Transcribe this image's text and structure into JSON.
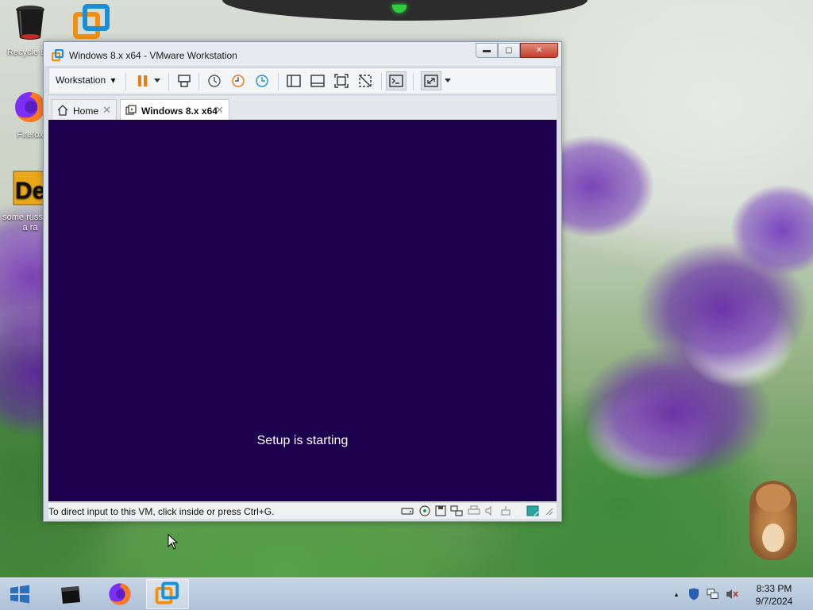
{
  "desktop": {
    "icons": [
      {
        "label": "Recycle Bin",
        "icon": "recycle-bin-icon"
      },
      {
        "label": "",
        "icon": "vmware-icon"
      },
      {
        "label": "Firefox",
        "icon": "firefox-icon"
      },
      {
        "label": "some russ ran a ra",
        "icon": "document-icon"
      }
    ]
  },
  "window": {
    "title": "Windows 8.x x64 - VMware Workstation",
    "controls": {
      "minimize": "▬",
      "maximize": "▢",
      "close": "✕"
    }
  },
  "toolbar": {
    "menu_label": "Workstation",
    "menu_arrow": "▾",
    "icons": [
      "pause-icon",
      "dropdown-arrow-icon",
      "send-ctrl-alt-del-icon",
      "snapshot-take-icon",
      "snapshot-revert-icon",
      "snapshot-manager-icon",
      "library-view-icon",
      "thumbnail-view-icon",
      "full-screen-icon",
      "unity-icon",
      "console-view-icon",
      "stretch-guest-icon",
      "stretch-dropdown-icon"
    ]
  },
  "tabs": [
    {
      "label": "Home",
      "close": "✕",
      "icon": "home-icon"
    },
    {
      "label": "Windows 8.x x64",
      "close": "✕",
      "icon": "vm-icon"
    }
  ],
  "vm_screen": {
    "message": "Setup is starting",
    "background": "#1c004e"
  },
  "statusbar": {
    "text": "To direct input to this VM, click inside or press Ctrl+G.",
    "icons": [
      "hard-disk-icon",
      "cd-dvd-icon",
      "floppy-icon",
      "network-icon",
      "printer-icon",
      "sound-icon",
      "usb-icon",
      "message-icon",
      "resize-grip-icon"
    ]
  },
  "taskbar": {
    "buttons": [
      {
        "app": "command-prompt-icon"
      },
      {
        "app": "firefox-icon"
      },
      {
        "app": "vmware-icon"
      }
    ],
    "tray": {
      "expand": "▲",
      "icons": [
        "shield-icon",
        "network-tray-icon",
        "volume-muted-icon"
      ],
      "time": "8:33 PM",
      "date": "9/7/2024"
    }
  },
  "colors": {
    "vm_background": "#1c004e",
    "close_button": "#c7402d",
    "vmware_orange": "#f29111",
    "vmware_blue": "#1a8fd6"
  }
}
